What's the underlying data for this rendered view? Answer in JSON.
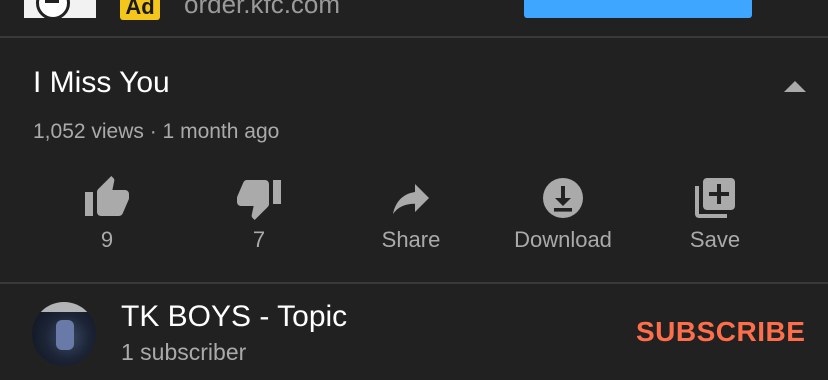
{
  "ad": {
    "badge": "Ad",
    "url": "order.kfc.com"
  },
  "video": {
    "title": "I Miss You",
    "meta": "1,052 views · 1 month ago"
  },
  "actions": {
    "like_count": "9",
    "dislike_count": "7",
    "share_label": "Share",
    "download_label": "Download",
    "save_label": "Save"
  },
  "channel": {
    "name": "TK BOYS - Topic",
    "subscribers": "1 subscriber",
    "subscribe_label": "SUBSCRIBE"
  },
  "colors": {
    "background": "#212121",
    "subscribe": "#ff6e4a",
    "ad_badge": "#f4c51a",
    "ad_cta": "#3ea6ff",
    "secondary_text": "#aaaaaa"
  },
  "icons": [
    "like-icon",
    "dislike-icon",
    "share-icon",
    "download-icon",
    "save-to-playlist-icon",
    "chevron-up-icon"
  ]
}
